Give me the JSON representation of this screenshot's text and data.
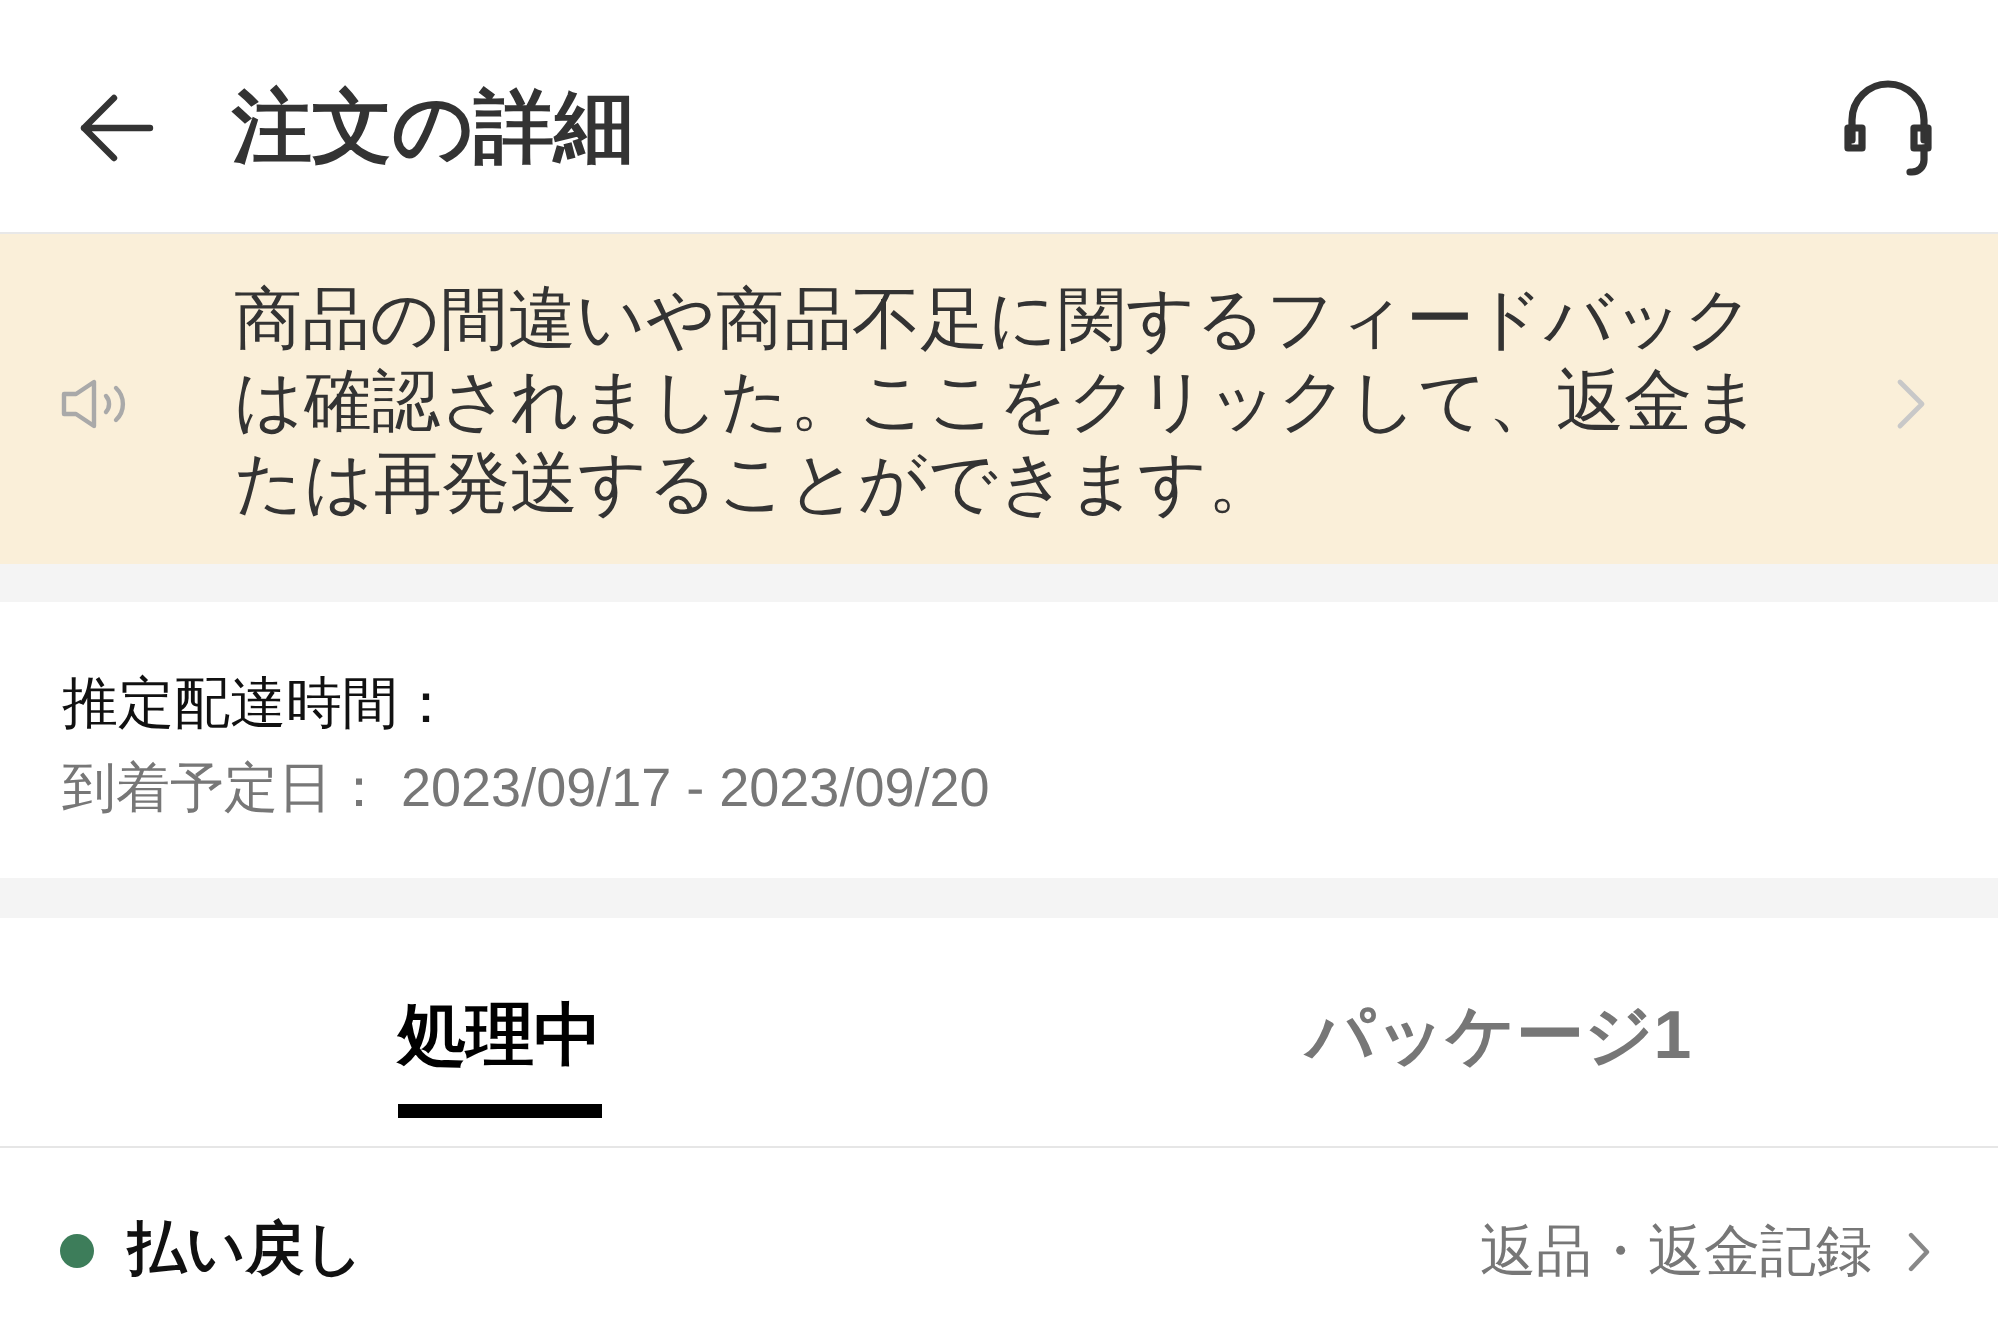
{
  "header": {
    "title": "注文の詳細"
  },
  "notice": {
    "text": "商品の間違いや商品不足に関するフィードバックは確認されました。ここをクリックして、返金または再発送することができます。"
  },
  "delivery": {
    "label": "推定配達時間：",
    "estimate": "到着予定日： 2023/09/17 - 2023/09/20"
  },
  "tabs": [
    {
      "label": "処理中",
      "selected": true
    },
    {
      "label": "パッケージ1",
      "selected": false
    }
  ],
  "status_row": {
    "status": "払い戻し",
    "color": "#3d7d5a",
    "link": "返品・返金記録"
  }
}
